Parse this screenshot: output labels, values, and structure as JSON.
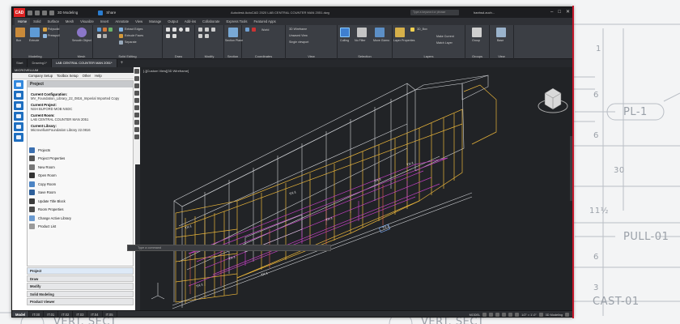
{
  "background": {
    "labels": [
      "PL-1",
      "PULL-01",
      "CAST-01",
      "VERT. SECT",
      "VERT. SECT"
    ],
    "dims": [
      "1",
      "6",
      "6",
      "30",
      "11½",
      "6",
      "3"
    ]
  },
  "titlebar": {
    "logo": "CAD",
    "workspace": "3D Modeling",
    "share": "Share",
    "title": "Autodesk AutoCAD 2020  LAB CENTRAL COUNTER MAN 2051.dwg",
    "search": "Type a keyword or phrase",
    "user": "hanhsd.zuch..."
  },
  "ribbon_tabs": [
    "Home",
    "Solid",
    "Surface",
    "Mesh",
    "Visualize",
    "Insert",
    "Annotate",
    "View",
    "Manage",
    "Output",
    "Add-ins",
    "Collaborate",
    "Express Tools",
    "Featured Apps"
  ],
  "ribbon": {
    "modeling": {
      "title": "Modeling",
      "box": "Box",
      "extrude": "Extrude",
      "polysolid": "Polysolid",
      "presspull": "Presspull"
    },
    "mesh": {
      "title": "Mesh",
      "smooth": "Smooth Object"
    },
    "solid_editing": {
      "title": "Solid Editing",
      "extract": "Extract Edges",
      "extrude_faces": "Extrude Faces",
      "separate": "Separate"
    },
    "draw": {
      "title": "Draw"
    },
    "modify": {
      "title": "Modify"
    },
    "section": {
      "title": "Section",
      "plane": "Section Plane"
    },
    "coordinates": {
      "title": "Coordinates",
      "world": "World"
    },
    "view": {
      "title": "View",
      "visual": "3D Wireframe",
      "unsaved": "Unsaved View",
      "viewport": "Single viewport"
    },
    "selection": {
      "title": "Selection",
      "culling": "Culling",
      "nofilter": "No Filter",
      "gizmo": "Move Gizmo"
    },
    "layers": {
      "title": "Layers",
      "props": "Layer Properties",
      "current": "3D_Box",
      "match_current": "Make Current",
      "match_layer": "Match Layer"
    },
    "groups": {
      "title": "Groups",
      "group": "Group"
    },
    "view2": {
      "title": "View",
      "base": "Base"
    }
  },
  "filetabs": [
    "Start",
    "Drawing1*",
    "LAB CENTRAL COUNTER MAN 2051*"
  ],
  "left": {
    "title": "MICROVELLUM",
    "menu": [
      "Company Setup",
      "Toolbox Setup",
      "Other",
      "Help"
    ],
    "header": "Project",
    "config_label": "Current Configuration:",
    "config": "MV_Foundation_Library_22_0816_Imperial Imported Copy",
    "project_label": "Current Project:",
    "project": "NSH BUFORD MOB NSDC",
    "room_label": "Current Room:",
    "room": "LAB CENTRAL COUNTER MAN 2051",
    "library_label": "Current Library:",
    "library": "MicrovellumFoundation Library 22.0816",
    "actions": [
      "Projects",
      "Project Properties",
      "New Room",
      "Open Room",
      "Copy Room",
      "Save Room",
      "Update Title Block",
      "Room Properties",
      "Change Active Library",
      "Product List"
    ],
    "sections": [
      "Project",
      "Draw",
      "Modify",
      "Solid Modeling",
      "Product Viewer"
    ]
  },
  "viewport": {
    "label": "[-][Custom View][3D Wireframe]",
    "cmd": "Type a command",
    "tags": [
      "TX-1",
      "TX-1",
      "TX-1",
      "TX-1",
      "TX-1",
      "TX-1",
      "TX-1",
      "TX-1",
      "TX-1"
    ]
  },
  "statusbar": {
    "tabs": [
      "Model",
      "IT.00",
      "IT.01",
      "IT.02",
      "IT.03",
      "IT.04",
      "IT.05"
    ],
    "mode": "MODEL",
    "scale": "1/2\" = 1'-0\"",
    "workspace": "3D Modeling"
  }
}
